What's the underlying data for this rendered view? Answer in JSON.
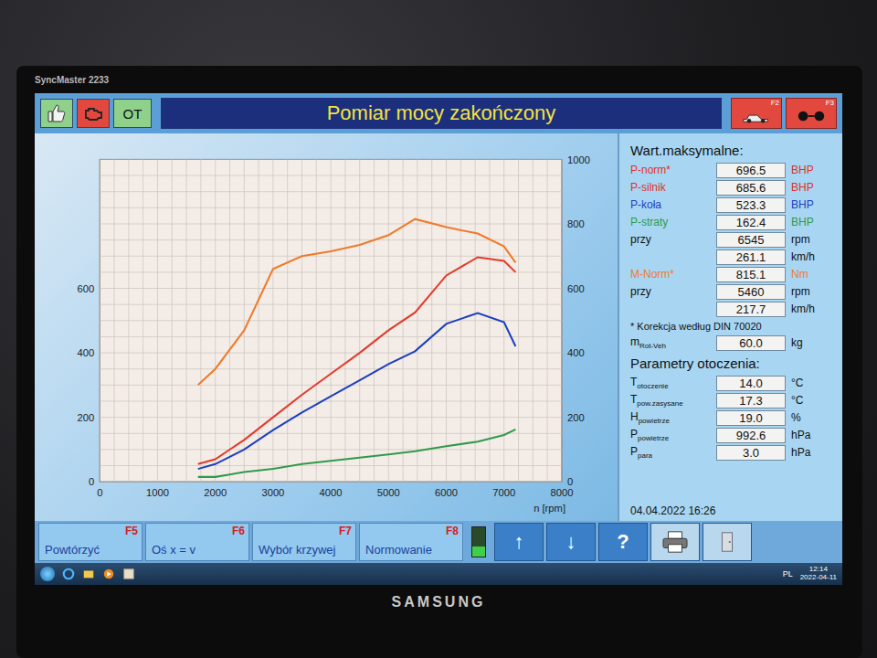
{
  "monitor": {
    "model": "SyncMaster 2233",
    "brand": "SAMSUNG"
  },
  "header": {
    "title": "Pomiar mocy zakończony",
    "ot_label": "OT",
    "buttons": [
      {
        "key": "F2"
      },
      {
        "key": "F3"
      }
    ]
  },
  "chart": {
    "x_axis": {
      "label": "n [rpm]",
      "range": [
        0,
        8000
      ],
      "ticks": [
        "0",
        "1000",
        "2000",
        "3000",
        "4000",
        "5000",
        "6000",
        "7000",
        "8000"
      ]
    },
    "left_axis": {
      "range": [
        0,
        1000
      ],
      "ticks": [
        "0",
        "200",
        "400",
        "600"
      ]
    },
    "right_axis": {
      "range": [
        0,
        1000
      ],
      "ticks": [
        "0",
        "200",
        "400",
        "600",
        "800",
        "1000"
      ]
    },
    "rpm": [
      1700,
      2000,
      2500,
      3000,
      3500,
      4000,
      4500,
      5000,
      5460,
      6000,
      6545,
      7000,
      7200
    ],
    "series": [
      {
        "color": "#f07a2a",
        "axis": "right",
        "values": [
          300,
          350,
          470,
          660,
          700,
          715,
          735,
          765,
          815,
          790,
          770,
          730,
          680
        ]
      },
      {
        "color": "#e23a2c",
        "axis": "left",
        "values": [
          55,
          70,
          130,
          200,
          270,
          335,
          400,
          470,
          525,
          640,
          696.5,
          685,
          650
        ]
      },
      {
        "color": "#1c3fc0",
        "axis": "left",
        "values": [
          40,
          55,
          100,
          160,
          215,
          265,
          315,
          365,
          405,
          490,
          523.3,
          495,
          420
        ]
      },
      {
        "color": "#2f9a4a",
        "axis": "left",
        "values": [
          15,
          15,
          30,
          40,
          55,
          65,
          75,
          85,
          95,
          110,
          125,
          145,
          162.4
        ]
      }
    ]
  },
  "maxima": {
    "title": "Wart.maksymalne:",
    "rows": [
      {
        "label": "P-norm*",
        "value": "696.5",
        "unit": "BHP",
        "color": "#e0302a"
      },
      {
        "label": "P-silnik",
        "value": "685.6",
        "unit": "BHP",
        "color": "#e0302a"
      },
      {
        "label": "P-koła",
        "value": "523.3",
        "unit": "BHP",
        "color": "#1c3fc0"
      },
      {
        "label": "P-straty",
        "value": "162.4",
        "unit": "BHP",
        "color": "#2f9a4a"
      },
      {
        "label": "przy",
        "value": "6545",
        "unit": "rpm",
        "color": "#111111"
      },
      {
        "label": "",
        "value": "261.1",
        "unit": "km/h",
        "color": "#111111"
      },
      {
        "label": "M-Norm*",
        "value": "815.1",
        "unit": "Nm",
        "color": "#f07a2a"
      },
      {
        "label": "przy",
        "value": "5460",
        "unit": "rpm",
        "color": "#111111"
      },
      {
        "label": "",
        "value": "217.7",
        "unit": "km/h",
        "color": "#111111"
      }
    ],
    "note": "* Korekcja według DIN 70020",
    "mass": {
      "label": "m",
      "sub": "Rot-Veh",
      "value": "60.0",
      "unit": "kg"
    }
  },
  "ambient": {
    "title": "Parametry otoczenia:",
    "rows": [
      {
        "label": "T",
        "sub": "otoczenie",
        "value": "14.0",
        "unit": "°C"
      },
      {
        "label": "T",
        "sub": "pow.zasysane",
        "value": "17.3",
        "unit": "°C"
      },
      {
        "label": "H",
        "sub": "powietrze",
        "value": "19.0",
        "unit": "%"
      },
      {
        "label": "P",
        "sub": "powietrze",
        "value": "992.6",
        "unit": "hPa"
      },
      {
        "label": "P",
        "sub": "para",
        "value": "3.0",
        "unit": "hPa"
      }
    ]
  },
  "timestamp": "04.04.2022 16:26",
  "function_keys": [
    {
      "label": "Powtórzyć",
      "key": "F5"
    },
    {
      "label": "Oś x = v",
      "key": "F6"
    },
    {
      "label": "Wybór krzywej",
      "key": "F7"
    },
    {
      "label": "Normowanie",
      "key": "F8"
    }
  ],
  "indicator": {
    "level": 0.35
  },
  "tool_buttons": [
    {
      "kind": "up",
      "label": "↑"
    },
    {
      "kind": "down",
      "label": "↓"
    },
    {
      "kind": "help",
      "label": "?"
    },
    {
      "kind": "print",
      "label": ""
    },
    {
      "kind": "exit",
      "label": ""
    }
  ],
  "taskbar": {
    "language": "PL",
    "time": "12:14",
    "date": "2022-04-11"
  }
}
